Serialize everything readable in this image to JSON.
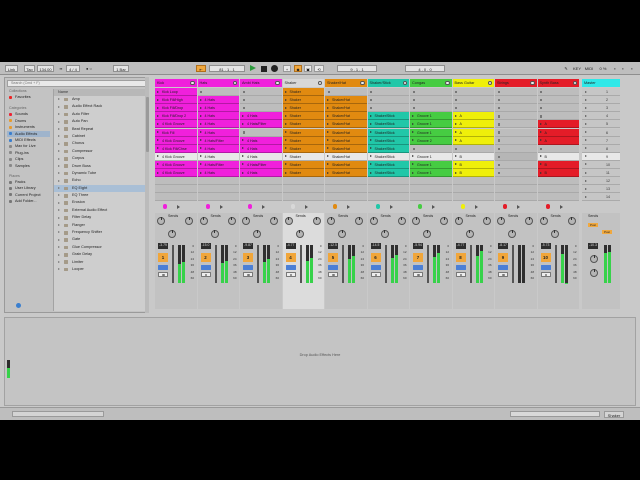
{
  "colors": {
    "pink": "#f020dc",
    "orange": "#e18a10",
    "yellow": "#efef0a",
    "red": "#e41c28",
    "teal": "#21c7a8",
    "green": "#46cc42",
    "cyan": "#2fe8e8",
    "shaker_header": "#d8d8d8",
    "launched": "#e8e8e8"
  },
  "control_bar": {
    "link": "Link",
    "tap": "Tap",
    "tempo": "134.00",
    "time_sig": "4 / 4",
    "loop_quant": "1 Bar",
    "position": "81 . 1 . 1",
    "loop_start": "9 . 1 . 1",
    "loop_length": "4 . 0 . 0",
    "play_icon": "play-icon",
    "stop_icon": "stop-icon",
    "record_icon": "record-icon"
  },
  "browser": {
    "search_placeholder": "Search (Cmd + F)",
    "collections_header": "Collections",
    "favorites": "Favorites",
    "categories_header": "Categories",
    "categories": [
      "Sounds",
      "Drums",
      "Instruments",
      "Audio Effects",
      "MIDI Effects",
      "Max for Live",
      "Plug-ins",
      "Clips",
      "Samples"
    ],
    "selected_category": "Audio Effects",
    "places_header": "Places",
    "places": [
      "Packs",
      "User Library",
      "Current Project",
      "Add Folder..."
    ],
    "list_header": "Name",
    "items": [
      "Amp",
      "Audio Effect Rack",
      "Auto Filter",
      "Auto Pan",
      "Beat Repeat",
      "Cabinet",
      "Chorus",
      "Compressor",
      "Corpus",
      "Drum Buss",
      "Dynamic Tube",
      "Echo",
      "EQ Eight",
      "EQ Three",
      "Erosion",
      "External Audio Effect",
      "Filter Delay",
      "Flanger",
      "Frequency Shifter",
      "Gate",
      "Glue Compressor",
      "Grain Delay",
      "Limiter",
      "Looper"
    ],
    "selected_item": "EQ Eight"
  },
  "tracks": [
    {
      "name": "Kick",
      "color": "#f020dc",
      "num": "1",
      "vol": "-3.79",
      "clips": [
        "Kick Loop",
        "Kick Fill/High",
        "Kick Fill/Drop",
        "Kick Fill/Drop 2",
        "4 Kick Groove",
        "Kick Fill",
        "4 Kick Groove",
        "4 Kick Fill/Chse",
        "4 Kick Groove",
        "4 Kick Groove",
        "4 Kick Groove"
      ]
    },
    {
      "name": "Hats",
      "color": "#f020dc",
      "num": "2",
      "vol": "-15.0",
      "clips": [
        "",
        "4 Hats",
        "4 Hats",
        "4 Hats",
        "4 Hats",
        "4 Hats",
        "4 Hats/Filter",
        "4 Hats",
        "4 Hats",
        "4 Hats/Filter",
        "4 Hats"
      ]
    },
    {
      "name": "Ambi Hats",
      "color": "#f020dc",
      "num": "3",
      "vol": "-9.87",
      "clips": [
        "",
        "",
        "",
        "4 Hats",
        "4 Hats/Filter",
        "",
        "4 Hats",
        "4 Hats",
        "4 Hats",
        "4 Hats/Filter",
        "4 Hats"
      ]
    },
    {
      "name": "Shaker",
      "color": "#d8d8d8",
      "num": "4",
      "vol": "-4.77",
      "clips": [
        "Shaker",
        "Shaker",
        "Shaker",
        "Shaker",
        "Shaker",
        "Shaker",
        "Shaker",
        "Shaker",
        "Shaker",
        "Shaker",
        "Shaker"
      ]
    },
    {
      "name": "Shaker/Hat",
      "color": "#e18a10",
      "num": "5",
      "vol": "-12.5",
      "clips": [
        "",
        "Shaker/Hat",
        "Shaker/Hat",
        "Shaker/Hat",
        "Shaker/Hat",
        "Shaker/Hat",
        "Shaker/Hat",
        "Shaker/Hat",
        "Shaker/Hat",
        "Shaker/Hat",
        "Shaker/Hat"
      ]
    },
    {
      "name": "Shaker/Stick",
      "color": "#21c7a8",
      "num": "6",
      "vol": "-14.5",
      "clips": [
        "",
        "",
        "",
        "Shaker/Stick",
        "Shaker/Stick",
        "Shaker/Stick",
        "Shaker/Stick",
        "Shaker/Stick",
        "Shaker/Stick",
        "Shaker/Stick",
        "Shaker/Stick"
      ]
    },
    {
      "name": "Congas",
      "color": "#46cc42",
      "num": "7",
      "vol": "-5.94",
      "clips": [
        "",
        "",
        "",
        "Groove 1",
        "Groove 1",
        "Groove 1",
        "Groove 2",
        "",
        "Groove 1",
        "Groove 1",
        "Groove 1"
      ]
    },
    {
      "name": "Bass Guitar",
      "color": "#efef0a",
      "num": "8",
      "vol": "-4.77",
      "clips": [
        "",
        "",
        "",
        "A",
        "A",
        "A",
        "A",
        "",
        "B",
        "B",
        "B"
      ]
    },
    {
      "name": "Strings",
      "color": "#e41c28",
      "num": "9",
      "vol": "-8.17",
      "clips": [
        "",
        "",
        "",
        "",
        "",
        "",
        "",
        "",
        "",
        "",
        ""
      ]
    },
    {
      "name": "Synth Bass",
      "color": "#e41c28",
      "num": "10",
      "vol": "-5.73",
      "clips": [
        "",
        "",
        "",
        "",
        "A",
        "A",
        "A",
        "",
        "B",
        "B",
        "B"
      ]
    }
  ],
  "master": {
    "name": "Master",
    "vol": "-10.3",
    "post": "Post",
    "scenes": [
      "1",
      "2",
      "3",
      "4",
      "5",
      "6",
      "7",
      "8",
      "9",
      "10",
      "11",
      "12",
      "13",
      "14"
    ]
  },
  "mixer_labels": {
    "sends": "Sends",
    "A": "A",
    "B": "B",
    "scale": [
      "0",
      "12",
      "24",
      "36",
      "48",
      "60"
    ]
  },
  "devices": {
    "drop_text": "Drop Audio Effects Here"
  },
  "status": {
    "track_label": "Shaker"
  }
}
